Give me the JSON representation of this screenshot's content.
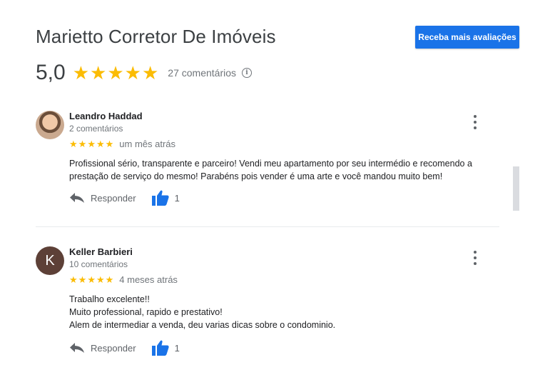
{
  "business": {
    "name": "Marietto Corretor De Imóveis",
    "cta_label": "Receba mais avaliações",
    "rating": "5,0",
    "stars": 5,
    "review_count_label": "27 comentários",
    "info_icon": "info-icon"
  },
  "colors": {
    "star": "#fbbc04",
    "accent": "#1a73e8",
    "like": "#1a73e8"
  },
  "reviews": [
    {
      "name": "Leandro Haddad",
      "meta": "2 comentários",
      "stars": 5,
      "time": "um mês atrás",
      "text": [
        "Profissional sério, transparente e parceiro! Vendi meu apartamento por seu intermédio e recomendo a",
        "prestação de serviço do mesmo! Parabéns pois vender é uma arte e você mandou muito bem!"
      ],
      "avatar": "avatar-photo",
      "reply_label": "Responder",
      "likes": "1"
    },
    {
      "name": "Keller Barbieri",
      "meta": "10 comentários",
      "stars": 5,
      "time": "4 meses atrás",
      "text": [
        "Trabalho excelente!!",
        "Muito professional, rapido e prestativo!",
        "Alem de intermediar a venda, deu varias dicas sobre o condominio."
      ],
      "avatar_letter": "K",
      "reply_label": "Responder",
      "likes": "1"
    }
  ]
}
